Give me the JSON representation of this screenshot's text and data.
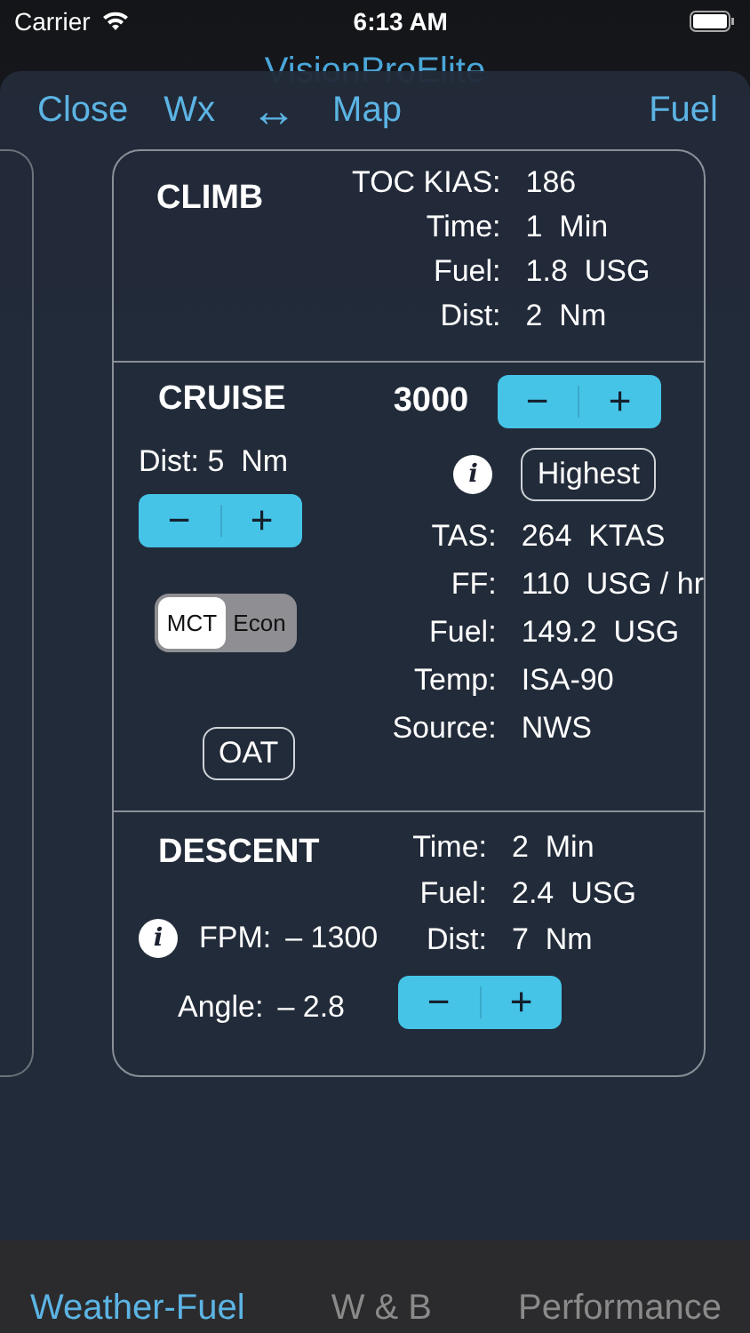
{
  "status_bar": {
    "carrier": "Carrier",
    "time": "6:13 AM"
  },
  "app_title": "VisionProElite",
  "nav": {
    "close": "Close",
    "wx": "Wx",
    "swap": "↔",
    "map": "Map",
    "fuel": "Fuel"
  },
  "climb": {
    "title": "CLIMB",
    "rows": [
      {
        "label": "TOC KIAS:",
        "value": "186"
      },
      {
        "label": "Time:",
        "value": "1  Min"
      },
      {
        "label": "Fuel:",
        "value": "1.8  USG"
      },
      {
        "label": "Dist:",
        "value": "2  Nm"
      }
    ]
  },
  "cruise": {
    "title": "CRUISE",
    "altitude": "3000",
    "dist": "Dist: 5  Nm",
    "stepper": {
      "minus": "−",
      "plus": "+"
    },
    "dist_stepper": {
      "minus": "−",
      "plus": "+"
    },
    "modes": [
      {
        "label": "MCT",
        "selected": true
      },
      {
        "label": "Econ",
        "selected": false
      }
    ],
    "info": "i",
    "highest": "Highest",
    "oat": "OAT",
    "rows": [
      {
        "label": "TAS:",
        "value": "264  KTAS"
      },
      {
        "label": "FF:",
        "value": "110  USG / hr"
      },
      {
        "label": "Fuel:",
        "value": "149.2  USG"
      },
      {
        "label": "Temp:",
        "value": "ISA-90"
      },
      {
        "label": "Source:",
        "value": "NWS"
      }
    ]
  },
  "descent": {
    "title": "DESCENT",
    "info": "i",
    "fpm": {
      "label": "FPM:",
      "value": "– 1300"
    },
    "angle": {
      "label": "Angle:",
      "value": "– 2.8"
    },
    "rows": [
      {
        "label": "Time:",
        "value": "2  Min"
      },
      {
        "label": "Fuel:",
        "value": "2.4  USG"
      },
      {
        "label": "Dist:",
        "value": "7  Nm"
      }
    ],
    "stepper": {
      "minus": "−",
      "plus": "+"
    }
  },
  "tabs": [
    {
      "label": "Weather-Fuel",
      "selected": true
    },
    {
      "label": "W & B",
      "selected": false
    },
    {
      "label": "Performance",
      "selected": false
    }
  ]
}
